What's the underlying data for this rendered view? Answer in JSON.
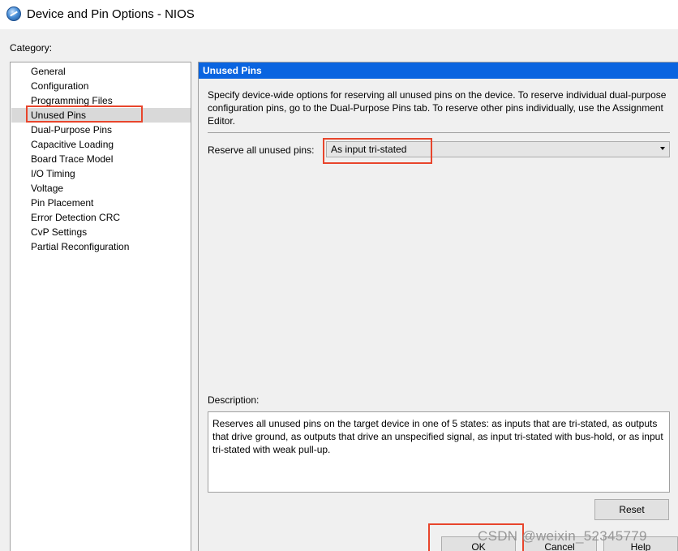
{
  "window": {
    "title": "Device and Pin Options - NIOS"
  },
  "sidebar": {
    "label": "Category:",
    "items": [
      {
        "label": "General"
      },
      {
        "label": "Configuration"
      },
      {
        "label": "Programming Files"
      },
      {
        "label": "Unused Pins",
        "selected": true
      },
      {
        "label": "Dual-Purpose Pins"
      },
      {
        "label": "Capacitive Loading"
      },
      {
        "label": "Board Trace Model"
      },
      {
        "label": "I/O Timing"
      },
      {
        "label": "Voltage"
      },
      {
        "label": "Pin Placement"
      },
      {
        "label": "Error Detection CRC"
      },
      {
        "label": "CvP Settings"
      },
      {
        "label": "Partial Reconfiguration"
      }
    ]
  },
  "panel": {
    "header": "Unused Pins",
    "intro": "Specify device-wide options for reserving all unused pins on the device. To reserve individual dual-purpose configuration pins, go to the Dual-Purpose Pins tab. To reserve other pins individually, use the Assignment Editor.",
    "reserve_label": "Reserve all unused pins:",
    "reserve_value": "As input tri-stated",
    "description_label": "Description:",
    "description_text": "Reserves all unused pins on the target device in one of 5 states: as inputs that are tri-stated, as outputs that drive ground, as outputs that drive an unspecified signal, as input tri-stated with bus-hold, or as input tri-stated with weak pull-up.",
    "reset_label": "Reset"
  },
  "footer": {
    "ok_label": "OK",
    "cancel_label": "Cancel",
    "help_label": "Help"
  },
  "watermark": "CSDN @weixin_52345779",
  "colors": {
    "header_blue": "#0a64e0",
    "highlight_red": "#e8452c",
    "selection_gray": "#d9d9d9"
  },
  "icons": {
    "app": "quartus-globe-icon",
    "dropdown": "chevron-down-icon"
  }
}
